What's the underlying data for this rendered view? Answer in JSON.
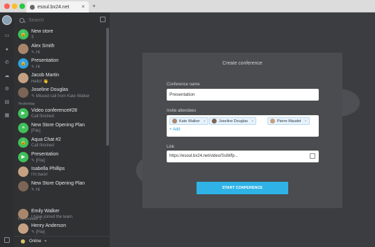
{
  "browser": {
    "tab_title": "esoul.bx24.net",
    "tab_close": "×",
    "new_tab": "+"
  },
  "sidebar": {
    "search_placeholder": "Search",
    "section_yesterday": "Yesterday",
    "section_previous": "Fri, October 1",
    "items": [
      {
        "name": "New store",
        "sub": "3",
        "avatar": "green",
        "glyph": "🔒"
      },
      {
        "name": "Alex Smith",
        "sub": "✎ Hi",
        "avatar": "person",
        "glyph": ""
      },
      {
        "name": "Presentation",
        "sub": "✎ Hi",
        "avatar": "blue",
        "glyph": "🔒"
      },
      {
        "name": "Jacob Martin",
        "sub": "Hello! 👋",
        "avatar": "person2",
        "glyph": ""
      },
      {
        "name": "Joseline Douglas",
        "sub": "✎ Missed call from Kate Walker",
        "avatar": "person3",
        "glyph": ""
      },
      {
        "name": "Video conference#28",
        "sub": "Call finished",
        "avatar": "green",
        "glyph": "▶"
      },
      {
        "name": "New Store Opening Plan",
        "sub": "[File]",
        "avatar": "green",
        "glyph": "≡"
      },
      {
        "name": "Aqua Chat #2",
        "sub": "Call finished",
        "avatar": "green",
        "glyph": "🔒"
      },
      {
        "name": "Presentation",
        "sub": "✎ [File]",
        "avatar": "green",
        "glyph": "▶"
      },
      {
        "name": "Isabella Phillips",
        "sub": "I'm back!",
        "avatar": "person2",
        "glyph": ""
      },
      {
        "name": "New Store Opening Plan",
        "sub": "✎ Hi",
        "avatar": "person3",
        "glyph": ""
      },
      {
        "name": "Emily Walker",
        "sub": "I have joined the team.",
        "avatar": "person",
        "glyph": ""
      },
      {
        "name": "Henry Anderson",
        "sub": "✎ [File]",
        "avatar": "person2",
        "glyph": ""
      }
    ],
    "status": "Online",
    "status_caret": "▾"
  },
  "modal": {
    "title": "Create conference",
    "name_label": "Conference name",
    "name_value": "Presentation",
    "invite_label": "Invite attendees",
    "attendees": [
      "Kate Walker",
      "Joseline Douglas",
      "Pierre Maudet"
    ],
    "chip_remove": "×",
    "add_label": "+ Add",
    "link_label": "Link",
    "link_value": "https://esoul.bx24.net/video/SsiWfp...",
    "start_label": "START CONFERENCE"
  },
  "colors": {
    "accent": "#2fb3e6",
    "green": "#3fbf5a",
    "blue": "#2f9fe0"
  }
}
